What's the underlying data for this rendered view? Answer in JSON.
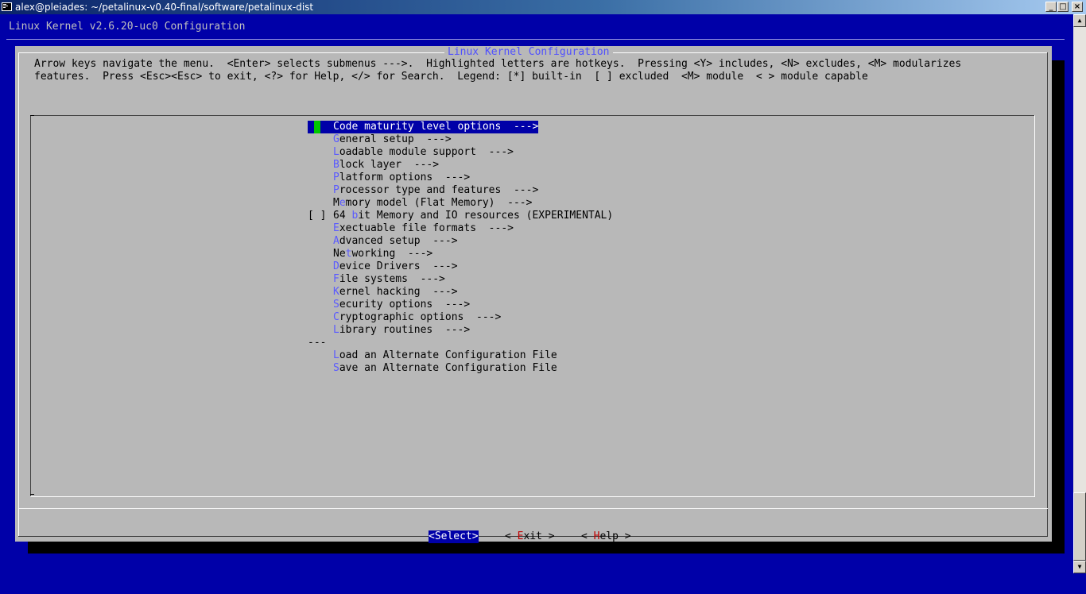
{
  "window": {
    "title": "alex@pleiades: ~/petalinux-v0.40-final/software/petalinux-dist",
    "minimize_label": "_",
    "maximize_label": "□",
    "close_label": "×"
  },
  "terminal": {
    "backtitle": "Linux Kernel v2.6.20-uc0 Configuration"
  },
  "dialog": {
    "title": "Linux Kernel Configuration",
    "help_line1": "Arrow keys navigate the menu.  <Enter> selects submenus --->.  Highlighted letters are hotkeys.  Pressing <Y> includes, <N> excludes, <M> modularizes",
    "help_line2": "features.  Press <Esc><Esc> to exit, <?> for Help, </> for Search.  Legend: [*] built-in  [ ] excluded  <M> module  < > module capable"
  },
  "menu": {
    "items": [
      {
        "prefix": "",
        "pre": "",
        "hk": "C",
        "rest": "ode maturity level options  --->",
        "selected": true
      },
      {
        "prefix": "",
        "pre": "",
        "hk": "G",
        "rest": "eneral setup  --->"
      },
      {
        "prefix": "",
        "pre": "",
        "hk": "L",
        "rest": "oadable module support  --->"
      },
      {
        "prefix": "",
        "pre": "",
        "hk": "B",
        "rest": "lock layer  --->"
      },
      {
        "prefix": "",
        "pre": "",
        "hk": "P",
        "rest": "latform options  --->"
      },
      {
        "prefix": "",
        "pre": "",
        "hk": "P",
        "rest": "rocessor type and features  --->"
      },
      {
        "prefix": "",
        "pre": "M",
        "hk": "e",
        "rest": "mory model (Flat Memory)  --->"
      },
      {
        "prefix": "[ ]",
        "pre": "64 ",
        "hk": "b",
        "rest": "it Memory and IO resources (EXPERIMENTAL)"
      },
      {
        "prefix": "",
        "pre": "",
        "hk": "E",
        "rest": "xectuable file formats  --->"
      },
      {
        "prefix": "",
        "pre": "",
        "hk": "A",
        "rest": "dvanced setup  --->"
      },
      {
        "prefix": "",
        "pre": "Ne",
        "hk": "t",
        "rest": "working  --->"
      },
      {
        "prefix": "",
        "pre": "",
        "hk": "D",
        "rest": "evice Drivers  --->"
      },
      {
        "prefix": "",
        "pre": "",
        "hk": "F",
        "rest": "ile systems  --->"
      },
      {
        "prefix": "",
        "pre": "",
        "hk": "K",
        "rest": "ernel hacking  --->"
      },
      {
        "prefix": "",
        "pre": "",
        "hk": "S",
        "rest": "ecurity options  --->"
      },
      {
        "prefix": "",
        "pre": "",
        "hk": "C",
        "rest": "ryptographic options  --->"
      },
      {
        "prefix": "",
        "pre": "",
        "hk": "L",
        "rest": "ibrary routines  --->"
      },
      {
        "prefix": "---",
        "pre": "",
        "hk": "",
        "rest": ""
      },
      {
        "prefix": "",
        "pre": "",
        "hk": "L",
        "rest": "oad an Alternate Configuration File"
      },
      {
        "prefix": "",
        "pre": "",
        "hk": "S",
        "rest": "ave an Alternate Configuration File"
      }
    ]
  },
  "buttons": {
    "select": {
      "text": "<Select>"
    },
    "exit": {
      "pre": "< ",
      "hk": "E",
      "rest": "xit >"
    },
    "help": {
      "pre": "< ",
      "hk": "H",
      "rest": "elp >"
    }
  },
  "colors": {
    "background": "#0000a8",
    "dialog": "#b8b8b8",
    "hotkey": "#5a5aff",
    "button_hotkey": "#c00000",
    "cursor": "#00c800"
  }
}
